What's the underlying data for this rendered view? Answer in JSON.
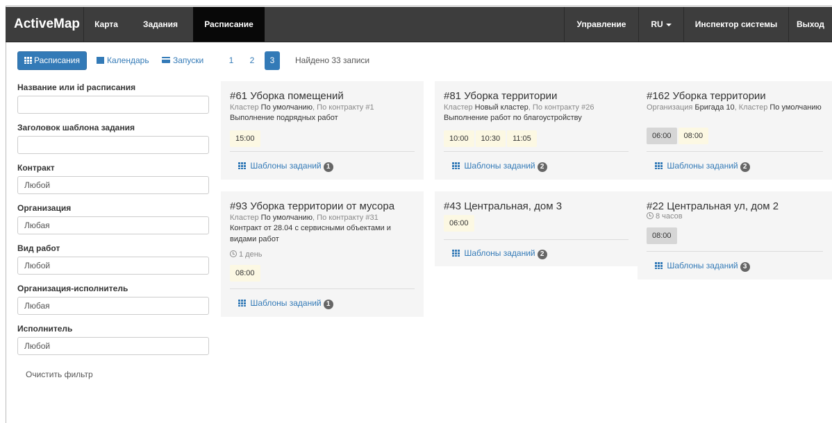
{
  "navbar": {
    "brand": "ActiveMap",
    "items": [
      "Карта",
      "Задания",
      "Расписание"
    ],
    "right_items": [
      "Управление",
      "RU",
      "Инспектор системы",
      "Выход"
    ]
  },
  "toolbar": {
    "views": [
      "Расписания",
      "Календарь",
      "Запуски"
    ],
    "pages": [
      "1",
      "2",
      "3"
    ],
    "active_page": "3",
    "found": "Найдено 33 записи"
  },
  "filter": {
    "fields": [
      {
        "label": "Название или id расписания",
        "value": "",
        "placeholder": ""
      },
      {
        "label": "Заголовок шаблона задания",
        "value": "",
        "placeholder": ""
      },
      {
        "label": "Контракт",
        "value": "Любой"
      },
      {
        "label": "Организация",
        "value": "Любая"
      },
      {
        "label": "Вид работ",
        "value": "Любой"
      },
      {
        "label": "Организация-исполнитель",
        "value": "Любая"
      },
      {
        "label": "Исполнитель",
        "value": "Любой"
      }
    ],
    "clear": "Очистить фильтр"
  },
  "cards": [
    {
      "title": "#61 Уборка помещений",
      "meta": [
        [
          "Кластер",
          "По умолчанию"
        ],
        [
          "По контракту",
          "#1"
        ]
      ],
      "desc": "Выполнение подрядных работ",
      "times": [
        "15:00"
      ],
      "link": "Шаблоны заданий",
      "count": "1"
    },
    {
      "title": "#81 Уборка территории",
      "meta": [
        [
          "Кластер",
          "Новый кластер"
        ],
        [
          "По контракту",
          "#26"
        ]
      ],
      "desc": "Выполнение работ по благоустройству",
      "times": [
        "10:00",
        "10:30",
        "11:05"
      ],
      "link": "Шаблоны заданий",
      "count": "2"
    },
    {
      "title": "#162 Уборка территории",
      "meta_line1": "Организация",
      "meta_val1": "Бригада 10",
      "meta_line2": "Кластер",
      "meta_val2": "По умолчанию",
      "times": [
        "06:00",
        "08:00"
      ],
      "link": "Шаблоны заданий",
      "count": "2"
    },
    {
      "title": "#93 Уборка территории от мусора",
      "meta": [
        [
          "Кластер",
          "По умолчанию"
        ],
        [
          "По контракту",
          "#31"
        ]
      ],
      "desc": "Контракт от 28.04 с сервисными объектами и видами работ",
      "duration": "1 день",
      "times": [
        "08:00"
      ],
      "link": "Шаблоны заданий",
      "count": "1"
    },
    {
      "title": "#43 Центральная, дом 3",
      "times": [
        "06:00"
      ],
      "link": "Шаблоны заданий",
      "count": "2"
    },
    {
      "title": "#22 Центральная ул, дом 2",
      "duration": "8 часов",
      "times": [
        "08:00"
      ],
      "link": "Шаблоны заданий",
      "count": "3"
    }
  ]
}
